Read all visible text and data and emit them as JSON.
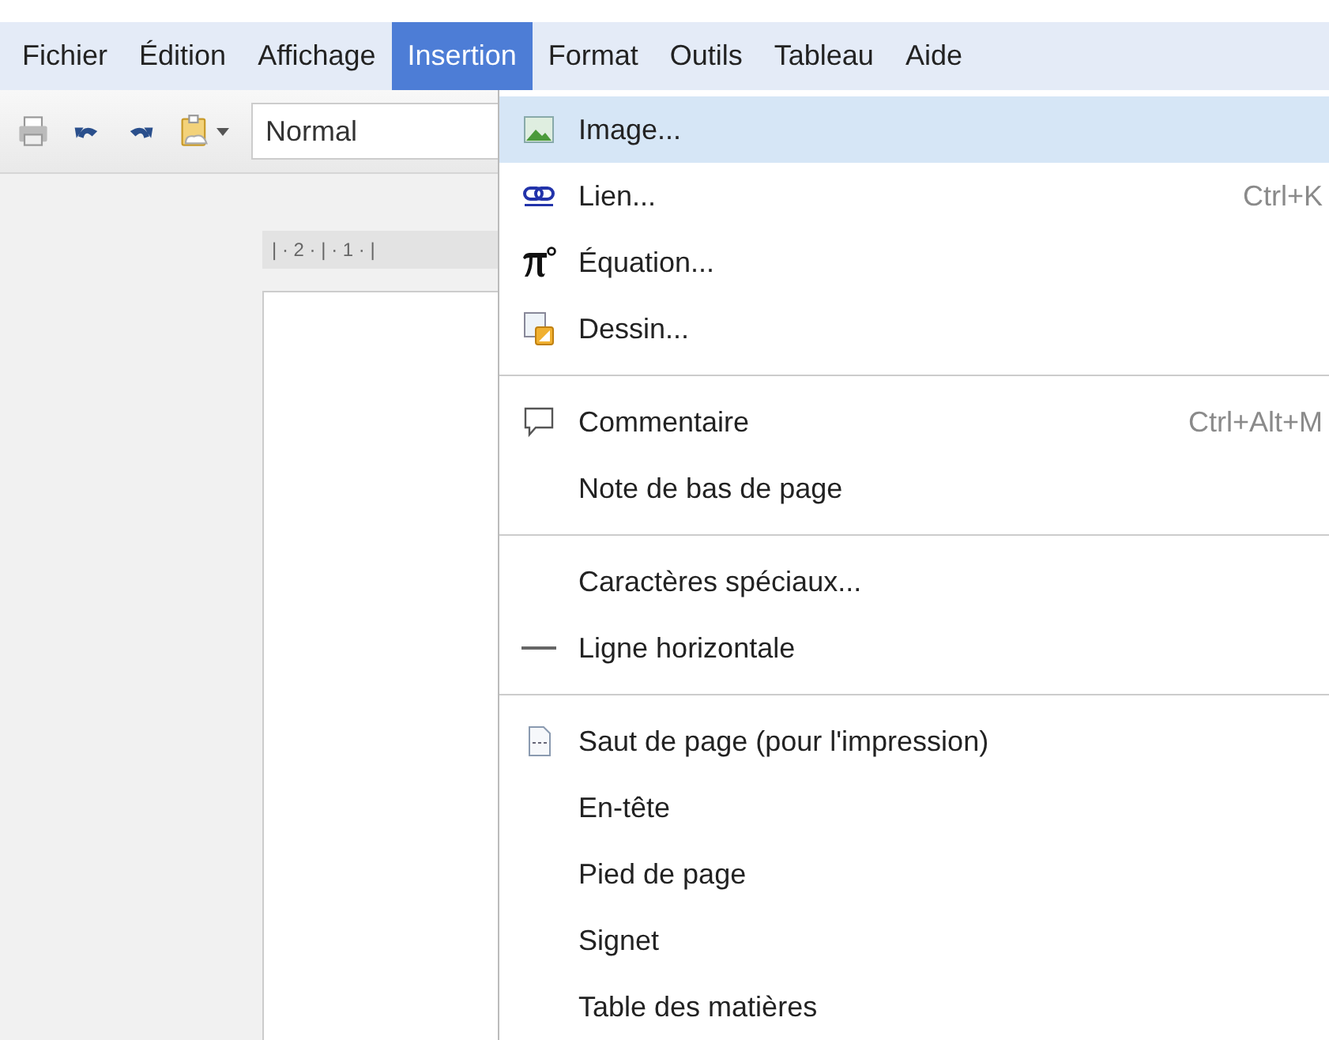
{
  "menu_bar": [
    {
      "label": "Fichier",
      "selected": false
    },
    {
      "label": "Édition",
      "selected": false
    },
    {
      "label": "Affichage",
      "selected": false
    },
    {
      "label": "Insertion",
      "selected": true
    },
    {
      "label": "Format",
      "selected": false
    },
    {
      "label": "Outils",
      "selected": false
    },
    {
      "label": "Tableau",
      "selected": false
    },
    {
      "label": "Aide",
      "selected": false
    }
  ],
  "toolbar": {
    "style_select": "Normal"
  },
  "ruler": "| · 2 · | · 1 · |",
  "menu": [
    {
      "kind": "item",
      "label": "Image...",
      "selected": true
    },
    {
      "kind": "item",
      "label": "Lien...",
      "shortcut": "Ctrl+K",
      "selected": false
    },
    {
      "kind": "item",
      "label": "Équation...",
      "selected": false
    },
    {
      "kind": "item",
      "label": "Dessin...",
      "selected": false
    },
    {
      "kind": "separator"
    },
    {
      "kind": "item",
      "label": "Commentaire",
      "shortcut": "Ctrl+Alt+M",
      "selected": false
    },
    {
      "kind": "item",
      "label": "Note de bas de page",
      "selected": false
    },
    {
      "kind": "separator"
    },
    {
      "kind": "item",
      "label": "Caractères spéciaux...",
      "selected": false
    },
    {
      "kind": "item",
      "label": "Ligne horizontale",
      "selected": false
    },
    {
      "kind": "separator"
    },
    {
      "kind": "item",
      "label": "Saut de page (pour l'impression)",
      "selected": false
    },
    {
      "kind": "item",
      "label": "En-tête",
      "selected": false
    },
    {
      "kind": "item",
      "label": "Pied de page",
      "selected": false
    },
    {
      "kind": "item",
      "label": "Signet",
      "selected": false
    },
    {
      "kind": "item",
      "label": "Table des matières",
      "selected": false
    }
  ]
}
